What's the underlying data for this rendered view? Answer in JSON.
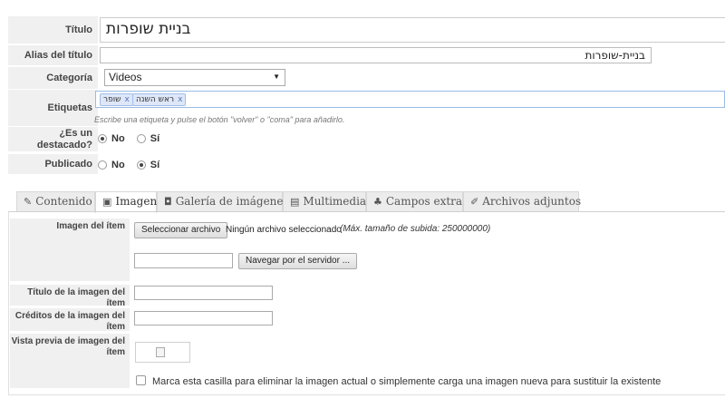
{
  "form": {
    "title_label": "Título",
    "title_value": "בניית שופרות",
    "alias_label": "Alias del título",
    "alias_value": "בניית-שופרות",
    "category_label": "Categoría",
    "category_value": "Videos",
    "tags_label": "Etiquetas",
    "tags": [
      "שופר",
      "ראש השנה"
    ],
    "tags_remove": "x",
    "tags_hint": "Escribe una etiqueta y pulse el botón \"volver\" o \"coma\" para añadirlo.",
    "featured_label": "¿Es un destacado?",
    "featured_no": "No",
    "featured_yes": "Sí",
    "featured_selected": "No",
    "published_label": "Publicado",
    "published_no": "No",
    "published_yes": "Sí",
    "published_selected": "Sí"
  },
  "tabs": [
    {
      "label": "Contenido",
      "icon": "edit-icon"
    },
    {
      "label": "Imagen",
      "icon": "image-icon",
      "active": true
    },
    {
      "label": "Galería de imágenes",
      "icon": "camera-icon"
    },
    {
      "label": "Multimedia",
      "icon": "film-icon"
    },
    {
      "label": "Campos extra",
      "icon": "plug-icon"
    },
    {
      "label": "Archivos adjuntos",
      "icon": "paperclip-icon"
    }
  ],
  "image_tab": {
    "item_image_label": "Imagen del ítem",
    "choose_file_button": "Seleccionar archivo",
    "no_file_text": "Ningún archivo seleccionado",
    "max_size_text": "(Máx. tamaño de subida: 250000000)",
    "browse_server_button": "Navegar por el servidor ...",
    "image_title_label": "Título de la imagen del ítem",
    "image_credits_label": "Créditos de la imagen del ítem",
    "preview_label": "Vista previa de imagen del ítem",
    "delete_checkbox_text": "Marca esta casilla para eliminar la imagen actual o simplemente carga una imagen nueva para sustituir la existente"
  }
}
